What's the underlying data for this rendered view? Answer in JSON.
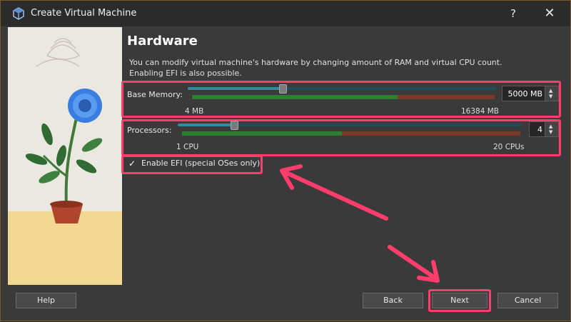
{
  "window": {
    "title": "Create Virtual Machine",
    "help_glyph": "?",
    "close_glyph": "✕"
  },
  "page": {
    "heading": "Hardware",
    "description_line1": "You can modify virtual machine's hardware by changing amount of RAM and virtual CPU count.",
    "description_line2": "Enabling EFI is also possible."
  },
  "memory": {
    "label": "Base Memory:",
    "min_label": "4 MB",
    "max_label": "16384 MB",
    "value_text": "5000 MB",
    "value": 5000,
    "min": 4,
    "max": 16384
  },
  "processors": {
    "label": "Processors:",
    "min_label": "1 CPU",
    "max_label": "20 CPUs",
    "value_text": "4",
    "value": 4,
    "min": 1,
    "max": 20
  },
  "efi": {
    "label": "Enable EFI (special OSes only)",
    "checked": true,
    "check_glyph": "✓"
  },
  "buttons": {
    "help": "Help",
    "back": "Back",
    "next": "Next",
    "cancel": "Cancel"
  },
  "colors": {
    "highlight": "#ff3d6a",
    "scale_green": "#2e7d32",
    "scale_red": "#7a3a2a",
    "slider_fill": "#2f8e9e"
  }
}
